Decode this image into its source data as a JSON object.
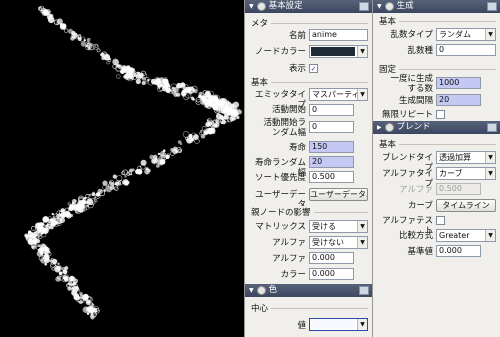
{
  "left_panel": {
    "title": "基本設定",
    "sec_meta": "メタ",
    "name_label": "名前",
    "name_value": "anime",
    "node_color_label": "ノードカラー",
    "node_color": "#1d2b36",
    "visible_label": "表示",
    "visible_checked": true,
    "sec_basic": "基本",
    "emitter_type_label": "エミッタタイプ",
    "emitter_type_value": "マスパーティクル",
    "active_start_label": "活動開始",
    "active_start_value": "0",
    "active_start_random_label": "活動開始ランダム幅",
    "active_start_random_value": "0",
    "life_label": "寿命",
    "life_value": "150",
    "life_random_label": "寿命ランダム幅",
    "life_random_value": "20",
    "sort_priority_label": "ソート優先度",
    "sort_priority_value": "0.500",
    "user_data_label": "ユーザーデータ",
    "user_data_button": "ユーザーデータ...",
    "sec_parent": "親ノードの影響",
    "matrix_label": "マトリックス",
    "matrix_value": "受ける",
    "alpha_label": "アルファ",
    "alpha_select": "受けない",
    "alpha2_label": "アルファ",
    "alpha2_value": "0.000",
    "color_label": "カラー",
    "color_value": "0.000",
    "color_panel_title": "色",
    "sec_center": "中心",
    "value_label": "値",
    "value_color": "#f8f8ff"
  },
  "right_panel": {
    "generate_title": "生成",
    "sec_basic": "基本",
    "random_type_label": "乱数タイプ",
    "random_type_value": "ランダム",
    "random_seed_label": "乱数種",
    "random_seed_value": "0",
    "sec_fixed": "固定",
    "gen_count_label": "一度に生成する数",
    "gen_count_value": "1000",
    "gen_interval_label": "生成間隔",
    "gen_interval_value": "20",
    "infinite_repeat_label": "無限リピート",
    "infinite_repeat_checked": false,
    "blend_title": "ブレンド",
    "sec_basic2": "基本",
    "blend_type_label": "ブレンドタイプ",
    "blend_type_value": "透過加算",
    "alpha_type_label": "アルファタイプ",
    "alpha_type_value": "カーブ",
    "alpha_label": "アルファ",
    "alpha_value": "0.500",
    "curve_label": "カーブ",
    "timeline_button": "タイムライン",
    "alpha_test_label": "アルファテスト",
    "alpha_test_checked": false,
    "compare_type_label": "比較方式",
    "compare_type_value": "Greater",
    "ref_value_label": "基準値",
    "ref_value": "0.000"
  },
  "icons": {
    "collapse": "triangle-down",
    "expand": "triangle-right",
    "gear": "gear",
    "dropdown": "triangle-down",
    "check": "✓"
  }
}
